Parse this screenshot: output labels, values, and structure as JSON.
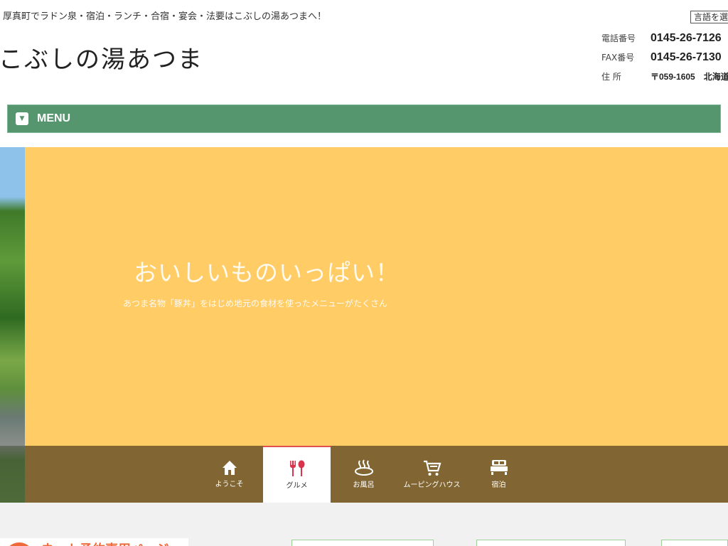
{
  "header": {
    "tagline": "厚真町でラドン泉・宿泊・ランチ・合宿・宴会・法要はこぶしの湯あつまへ！",
    "language_button": "言語を選択",
    "site_title": "こぶしの湯あつま"
  },
  "contact": {
    "phone_label": "電話番号",
    "phone": "0145-26-7126",
    "fax_label": "FAX番号",
    "fax": "0145-26-7130",
    "address_label": "住 所",
    "address": "〒059-1605　北海道"
  },
  "menu": {
    "label": "MENU",
    "color": "#55966f"
  },
  "hero": {
    "title": "おいしいものいっぱい！",
    "subtitle": "あつま名物「豚丼」をはじめ地元の食材を使ったメニューがたくさん",
    "panel_color": "#ffcc66"
  },
  "tabs": [
    {
      "label": "ようこそ",
      "icon": "home-icon",
      "active": false
    },
    {
      "label": "グルメ",
      "icon": "fork-spoon-icon",
      "active": true
    },
    {
      "label": "お風呂",
      "icon": "hot-spring-icon",
      "active": false
    },
    {
      "label": "ムーピングハウス",
      "icon": "cart-icon",
      "active": false
    },
    {
      "label": "宿泊",
      "icon": "bed-icon",
      "active": false
    }
  ],
  "footer": {
    "banner_text": "ネット予約専用ページ"
  }
}
